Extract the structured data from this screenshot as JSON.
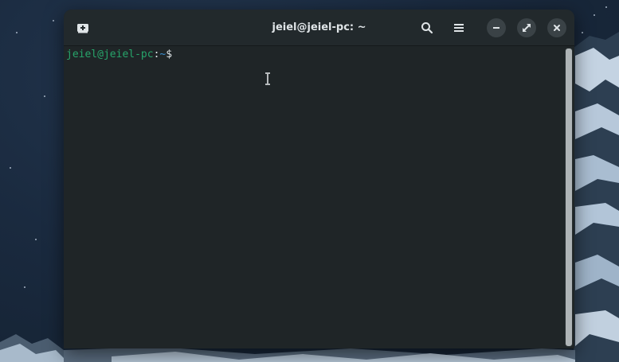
{
  "window": {
    "title": "jeiel@jeiel-pc: ~"
  },
  "titlebar": {
    "new_tab_icon": "new-tab-icon",
    "search_icon": "search-icon",
    "menu_icon": "hamburger-menu-icon",
    "minimize_icon": "minimize-icon",
    "maximize_icon": "maximize-icon",
    "close_icon": "close-icon"
  },
  "terminal": {
    "prompt_user_host": "jeiel@jeiel-pc",
    "prompt_colon": ":",
    "prompt_path": "~",
    "prompt_symbol": "$"
  },
  "colors": {
    "prompt_user": "#27a56b",
    "prompt_path": "#3a8fd1",
    "terminal_bg": "#1f2527",
    "titlebar_bg": "#22292c"
  }
}
